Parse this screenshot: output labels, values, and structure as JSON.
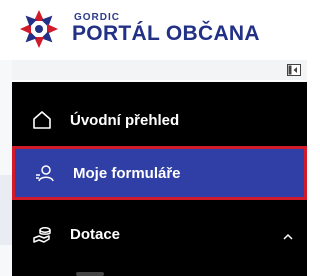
{
  "brand": {
    "company": "GORDIC",
    "portal_title": "PORTÁL OBČANA",
    "logo_icon": "gordic-logo-icon",
    "colors": {
      "primary": "#223186",
      "accent": "#d11a2a"
    }
  },
  "toolbar": {
    "collapse_icon": "sidebar-collapse-icon"
  },
  "sidebar": {
    "items": [
      {
        "label": "Úvodní přehled",
        "icon": "home-icon"
      },
      {
        "label": "Moje formuláře",
        "icon": "user-forms-icon",
        "selected": true
      },
      {
        "label": "Dotace",
        "icon": "grants-icon",
        "expanded": true
      }
    ],
    "highlight_color": "#2f3fa6",
    "background": "#000000"
  }
}
